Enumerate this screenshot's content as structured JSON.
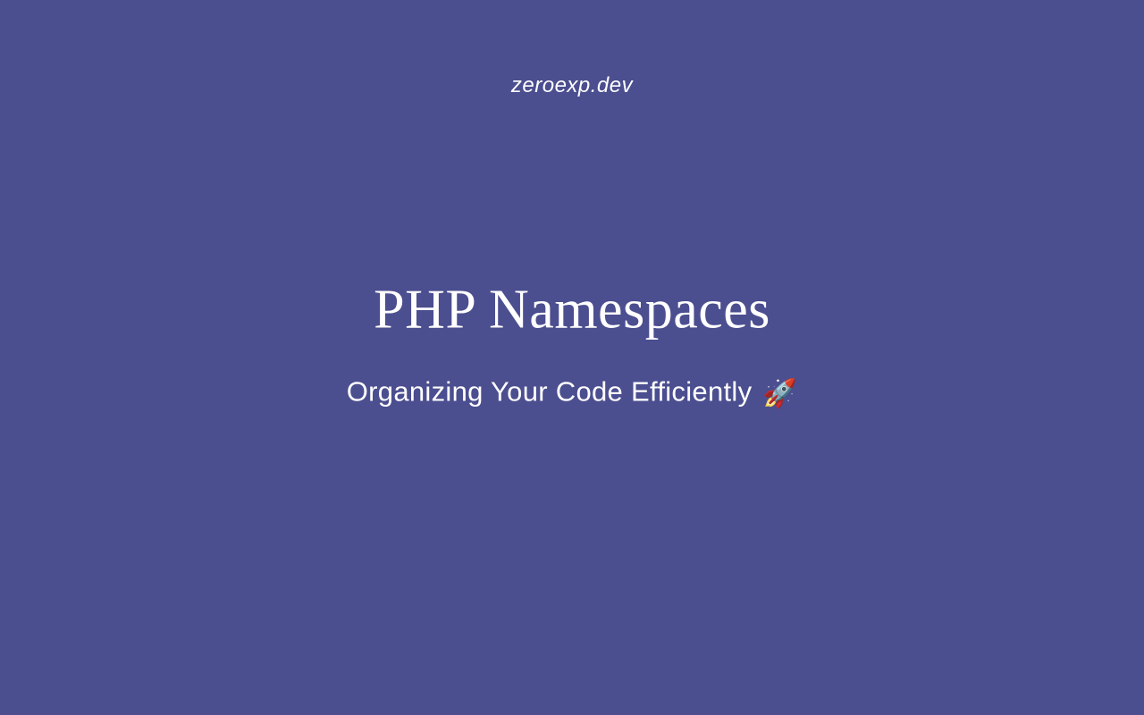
{
  "site_name": "zeroexp.dev",
  "title": "PHP Namespaces",
  "subtitle": "Organizing Your Code Efficiently",
  "icon": "🚀"
}
